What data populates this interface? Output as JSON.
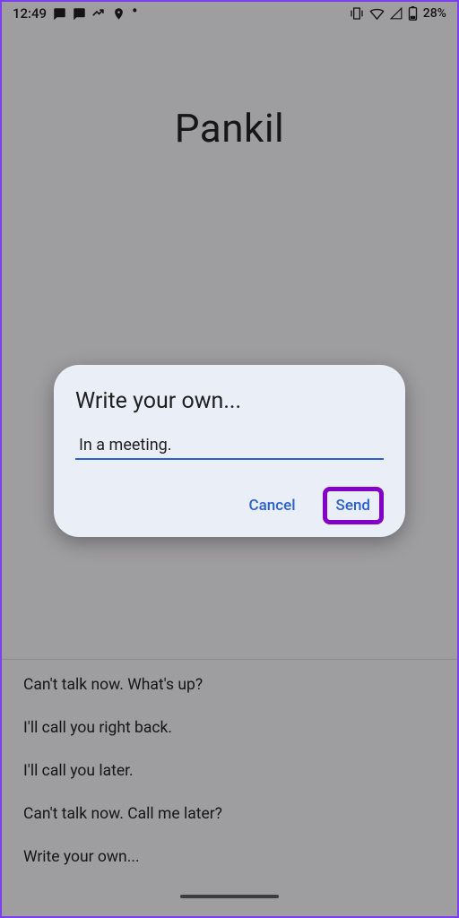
{
  "status": {
    "time": "12:49",
    "battery": "28%"
  },
  "caller_name": "Pankil",
  "dialog": {
    "title": "Write your own...",
    "input_value": "In a meeting.",
    "cancel_label": "Cancel",
    "send_label": "Send"
  },
  "quick_responses": {
    "items": [
      {
        "label": "Can't talk now. What's up?"
      },
      {
        "label": "I'll call you right back."
      },
      {
        "label": "I'll call you later."
      },
      {
        "label": "Can't talk now. Call me later?"
      },
      {
        "label": "Write your own..."
      }
    ]
  }
}
